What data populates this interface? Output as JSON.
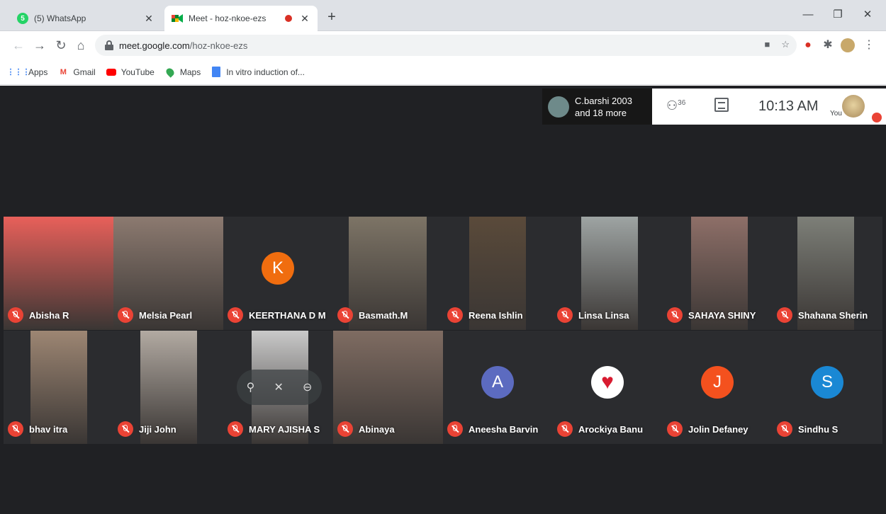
{
  "browser": {
    "tabs": [
      {
        "title": "(5) WhatsApp",
        "badge": "5",
        "favicon": "whatsapp-icon"
      },
      {
        "title": "Meet - hoz-nkoe-ezs",
        "favicon": "meet-icon",
        "recording": true
      }
    ],
    "url_host": "meet.google.com",
    "url_path": "/hoz-nkoe-ezs",
    "bookmarks": [
      {
        "label": "Apps",
        "icon": "apps-grid-icon"
      },
      {
        "label": "Gmail",
        "icon": "gmail-icon"
      },
      {
        "label": "YouTube",
        "icon": "youtube-icon"
      },
      {
        "label": "Maps",
        "icon": "maps-icon"
      },
      {
        "label": "In vitro induction of...",
        "icon": "docs-icon"
      }
    ]
  },
  "meet": {
    "presenter_line1": "C.barshi 2003",
    "presenter_line2": "and 18 more",
    "people_count": "36",
    "time": "10:13 AM",
    "you_label": "You",
    "participants": [
      {
        "name": "Abisha R",
        "tile": "video",
        "color": "#e8605a"
      },
      {
        "name": "Melsia Pearl",
        "tile": "video",
        "color": "#8c7a70"
      },
      {
        "name": "KEERTHANA D M",
        "tile": "avatar",
        "letter": "K",
        "color": "#f06d0f"
      },
      {
        "name": "Basmath.M",
        "tile": "video",
        "color": "#7d7466"
      },
      {
        "name": "Reena Ishlin",
        "tile": "video",
        "color": "#5a4a3a"
      },
      {
        "name": "Linsa Linsa",
        "tile": "video",
        "color": "#9ea4a3"
      },
      {
        "name": "SAHAYA SHINY",
        "tile": "video",
        "color": "#8e6f68"
      },
      {
        "name": "Shahana Sherin",
        "tile": "video",
        "color": "#7d7f78"
      },
      {
        "name": "bhav itra",
        "tile": "video",
        "color": "#9d8673"
      },
      {
        "name": "Jiji John",
        "tile": "video",
        "color": "#b2aaa2"
      },
      {
        "name": "MARY AJISHA S",
        "tile": "video",
        "color": "#c9c9c9"
      },
      {
        "name": "Abinaya",
        "tile": "video",
        "color": "#7f6c62"
      },
      {
        "name": "Aneesha Barvin",
        "tile": "avatar",
        "letter": "A",
        "color": "#5c6bc0"
      },
      {
        "name": "Arockiya Banu",
        "tile": "avatar",
        "letter": "",
        "color": "#ffffff"
      },
      {
        "name": "Jolin Defaney",
        "tile": "avatar",
        "letter": "J",
        "color": "#f4511e"
      },
      {
        "name": "Sindhu S",
        "tile": "avatar",
        "letter": "S",
        "color": "#1a88d4"
      }
    ]
  }
}
